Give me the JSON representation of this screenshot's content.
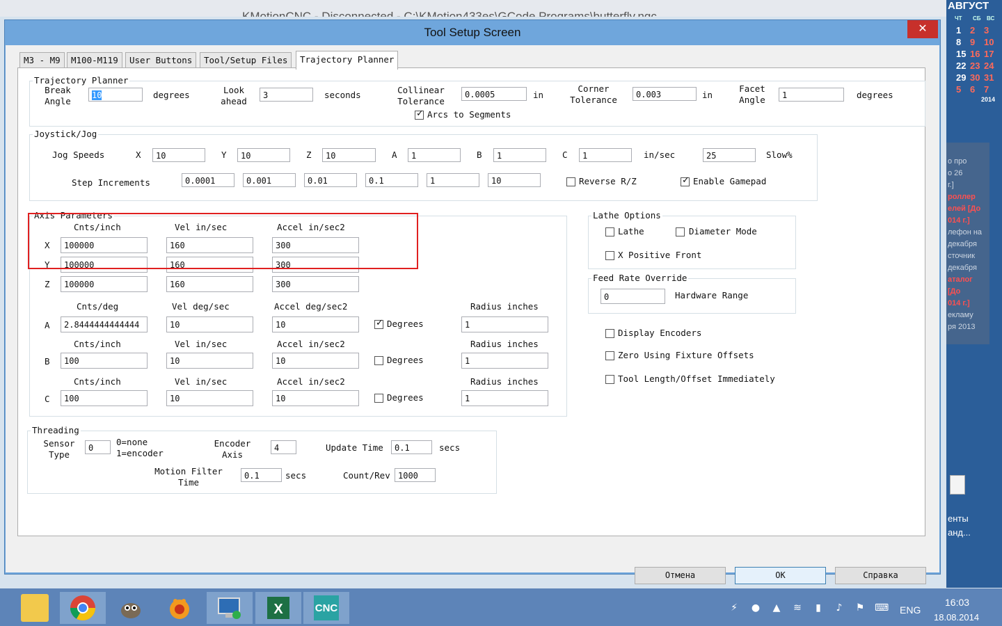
{
  "background_window": {
    "title": "KMotionCNC - Disconnected - C:\\KMotion433es\\GCode Programs\\butterfly.ngc"
  },
  "desktop": {
    "calendar_month": "АВГУСТ",
    "calendar_rows": [
      [
        "1",
        "2",
        "3"
      ],
      [
        "8",
        "9",
        "10"
      ],
      [
        "15",
        "16",
        "17"
      ],
      [
        "22",
        "23",
        "24"
      ],
      [
        "29",
        "30",
        "31"
      ],
      [
        "5",
        "6",
        "7"
      ]
    ],
    "calendar_dow": [
      "ЧТ",
      "СБ",
      "ВС"
    ],
    "calendar_year": "2014",
    "gadget_lines": [
      "о про",
      "о 26",
      "г.]",
      "роллер",
      "елей [До",
      "014 г.]",
      "лефон на",
      "декабря",
      "сточник",
      "декабря",
      "аталог",
      "[До",
      "014 г.]",
      "екламу",
      "ря 2013"
    ],
    "desktop_labels": [
      "енты",
      "анд..."
    ]
  },
  "dialog": {
    "title": "Tool Setup Screen",
    "close_glyph": "✕",
    "tabs": [
      "M3 - M9",
      "M100-M119",
      "User Buttons",
      "Tool/Setup Files",
      "Trajectory Planner"
    ],
    "active_tab": "Trajectory Planner",
    "trajectory": {
      "caption": "Trajectory Planner",
      "break_angle_label": [
        "Break",
        "Angle"
      ],
      "break_angle": "10",
      "degrees1": "degrees",
      "look_ahead_label": [
        "Look",
        "ahead"
      ],
      "look_ahead": "3",
      "seconds": "seconds",
      "collinear_label": [
        "Collinear",
        "Tolerance"
      ],
      "collinear": "0.0005",
      "in1": "in",
      "corner_label": [
        "Corner",
        "Tolerance"
      ],
      "corner": "0.003",
      "in2": "in",
      "facet_label": [
        "Facet",
        "Angle"
      ],
      "facet": "1",
      "degrees2": "degrees",
      "arcs_label": "Arcs to Segments",
      "arcs_checked": true
    },
    "jog": {
      "caption": "Joystick/Jog",
      "speeds_label": "Jog Speeds",
      "axes": [
        "X",
        "Y",
        "Z",
        "A",
        "B",
        "C"
      ],
      "speeds": [
        "10",
        "10",
        "10",
        "1",
        "1",
        "1"
      ],
      "units": "in/sec",
      "slow_value": "25",
      "slow_label": "Slow%",
      "step_label": "Step Increments",
      "steps": [
        "0.0001",
        "0.001",
        "0.01",
        "0.1",
        "1",
        "10"
      ],
      "reverse_label": "Reverse R/Z",
      "reverse_checked": false,
      "gamepad_label": "Enable Gamepad",
      "gamepad_checked": true
    },
    "axis": {
      "caption": "Axis Parameters",
      "linear_headers": [
        "Cnts/inch",
        "Vel in/sec",
        "Accel in/sec2"
      ],
      "rows": [
        {
          "axis": "X",
          "cnts": "100000",
          "vel": "160",
          "accel": "300"
        },
        {
          "axis": "Y",
          "cnts": "100000",
          "vel": "160",
          "accel": "300"
        },
        {
          "axis": "Z",
          "cnts": "100000",
          "vel": "160",
          "accel": "300"
        }
      ],
      "rot_headers_a": [
        "Cnts/deg",
        "Vel deg/sec",
        "Accel deg/sec2",
        "Radius inches"
      ],
      "rot_headers_bc": [
        "Cnts/inch",
        "Vel in/sec",
        "Accel in/sec2",
        "Radius inches"
      ],
      "rot_rows": [
        {
          "axis": "A",
          "cnts": "2.8444444444444",
          "vel": "10",
          "accel": "10",
          "degrees_checked": true,
          "radius": "1"
        },
        {
          "axis": "B",
          "cnts": "100",
          "vel": "10",
          "accel": "10",
          "degrees_checked": false,
          "radius": "1"
        },
        {
          "axis": "C",
          "cnts": "100",
          "vel": "10",
          "accel": "10",
          "degrees_checked": false,
          "radius": "1"
        }
      ],
      "degrees_label": "Degrees"
    },
    "lathe": {
      "caption": "Lathe Options",
      "lathe_label": "Lathe",
      "diameter_label": "Diameter Mode",
      "xpos_label": "X Positive Front"
    },
    "feed": {
      "caption": "Feed Rate Override",
      "value": "0",
      "hw_label": "Hardware Range"
    },
    "options": [
      "Display Encoders",
      "Zero Using Fixture Offsets",
      "Tool Length/Offset Immediately"
    ],
    "threading": {
      "caption": "Threading",
      "sensor_label": [
        "Sensor",
        "Type"
      ],
      "sensor": "0",
      "sensor_hint": [
        "0=none",
        "1=encoder"
      ],
      "encoder_label": [
        "Encoder",
        "Axis"
      ],
      "encoder": "4",
      "update_label": "Update Time",
      "update": "0.1",
      "secs1": "secs",
      "filter_label": [
        "Motion Filter",
        "Time"
      ],
      "filter": "0.1",
      "secs2": "secs",
      "count_label": "Count/Rev",
      "count": "1000"
    },
    "buttons": {
      "cancel": "Отмена",
      "ok": "OK",
      "help": "Справка"
    }
  },
  "taskbar": {
    "apps": [
      "file-explorer",
      "chrome",
      "gimp",
      "vlc",
      "remote-desktop",
      "excel",
      "kmotion-cnc"
    ],
    "language": "ENG",
    "time": "16:03",
    "date": "18.08.2014"
  },
  "colors": {
    "dialog_frame": "#6fa6dc",
    "close": "#c7302b",
    "taskbar": "#5d84b8",
    "highlight_box": "#e02020",
    "selection": "#3399ff"
  }
}
